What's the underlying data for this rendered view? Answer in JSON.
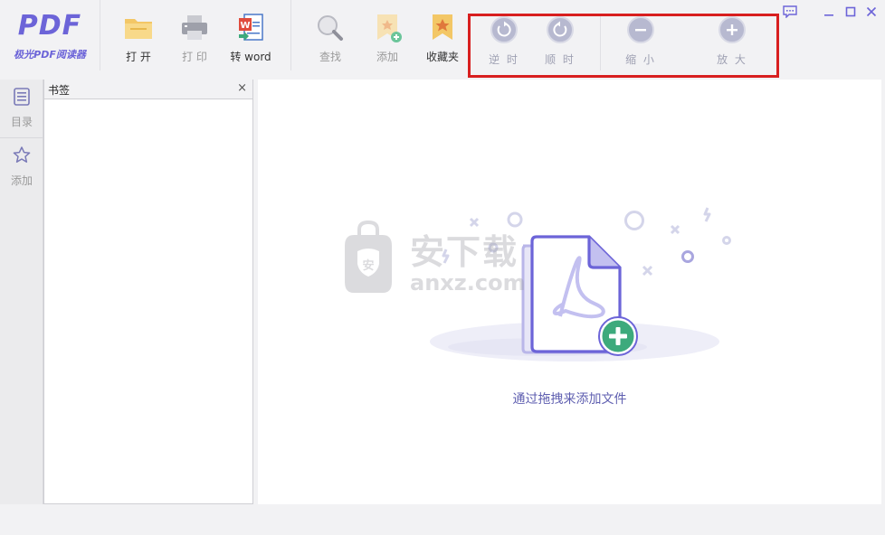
{
  "app": {
    "logo_text": "PDF",
    "logo_subtitle": "极光PDF阅读器"
  },
  "toolbar": {
    "open_label": "打 开",
    "print_label": "打 印",
    "to_word_label": "转 word",
    "find_label": "查找",
    "add_label": "添加",
    "favorites_label": "收藏夹",
    "rotate_ccw_label": "逆 时",
    "rotate_cw_label": "顺 时",
    "zoom_out_label": "缩 小",
    "zoom_in_label": "放 大"
  },
  "sidebar": {
    "items": [
      {
        "label": "目录",
        "icon": "list-icon"
      },
      {
        "label": "添加",
        "icon": "star-icon"
      }
    ]
  },
  "bookmark_panel": {
    "title": "书签",
    "close_glyph": "×"
  },
  "main": {
    "empty_hint": "通过拖拽来添加文件"
  },
  "watermark": {
    "text_cn": "安下载",
    "text_en": "anxz.com"
  },
  "colors": {
    "accent": "#6c64d8",
    "highlight": "#d81f1f",
    "add_green": "#3daa7c",
    "hint": "#5f5fb0"
  }
}
